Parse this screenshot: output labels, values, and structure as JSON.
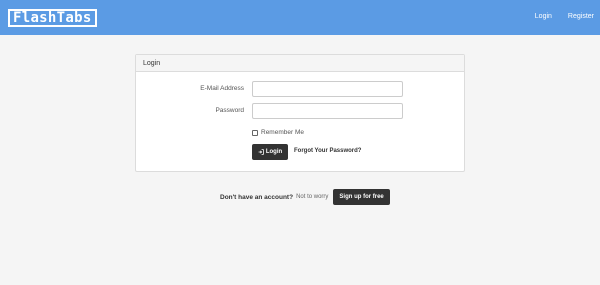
{
  "brand": {
    "logo_text": "FlashTabs"
  },
  "nav": {
    "login": "Login",
    "register": "Register"
  },
  "panel": {
    "heading": "Login",
    "email_label": "E-Mail Address",
    "password_label": "Password",
    "email_value": "",
    "password_value": "",
    "remember_label": "Remember Me",
    "remember_checked": false,
    "login_icon": "sign-in-icon",
    "login_button": "Login",
    "forgot_link": "Forgot Your Password?"
  },
  "signup": {
    "question": "Don't have an account?",
    "note": "Not to worry",
    "button": "Sign up for free"
  },
  "colors": {
    "navbar": "#5b9be4",
    "button": "#333333",
    "background": "#f5f5f5"
  }
}
